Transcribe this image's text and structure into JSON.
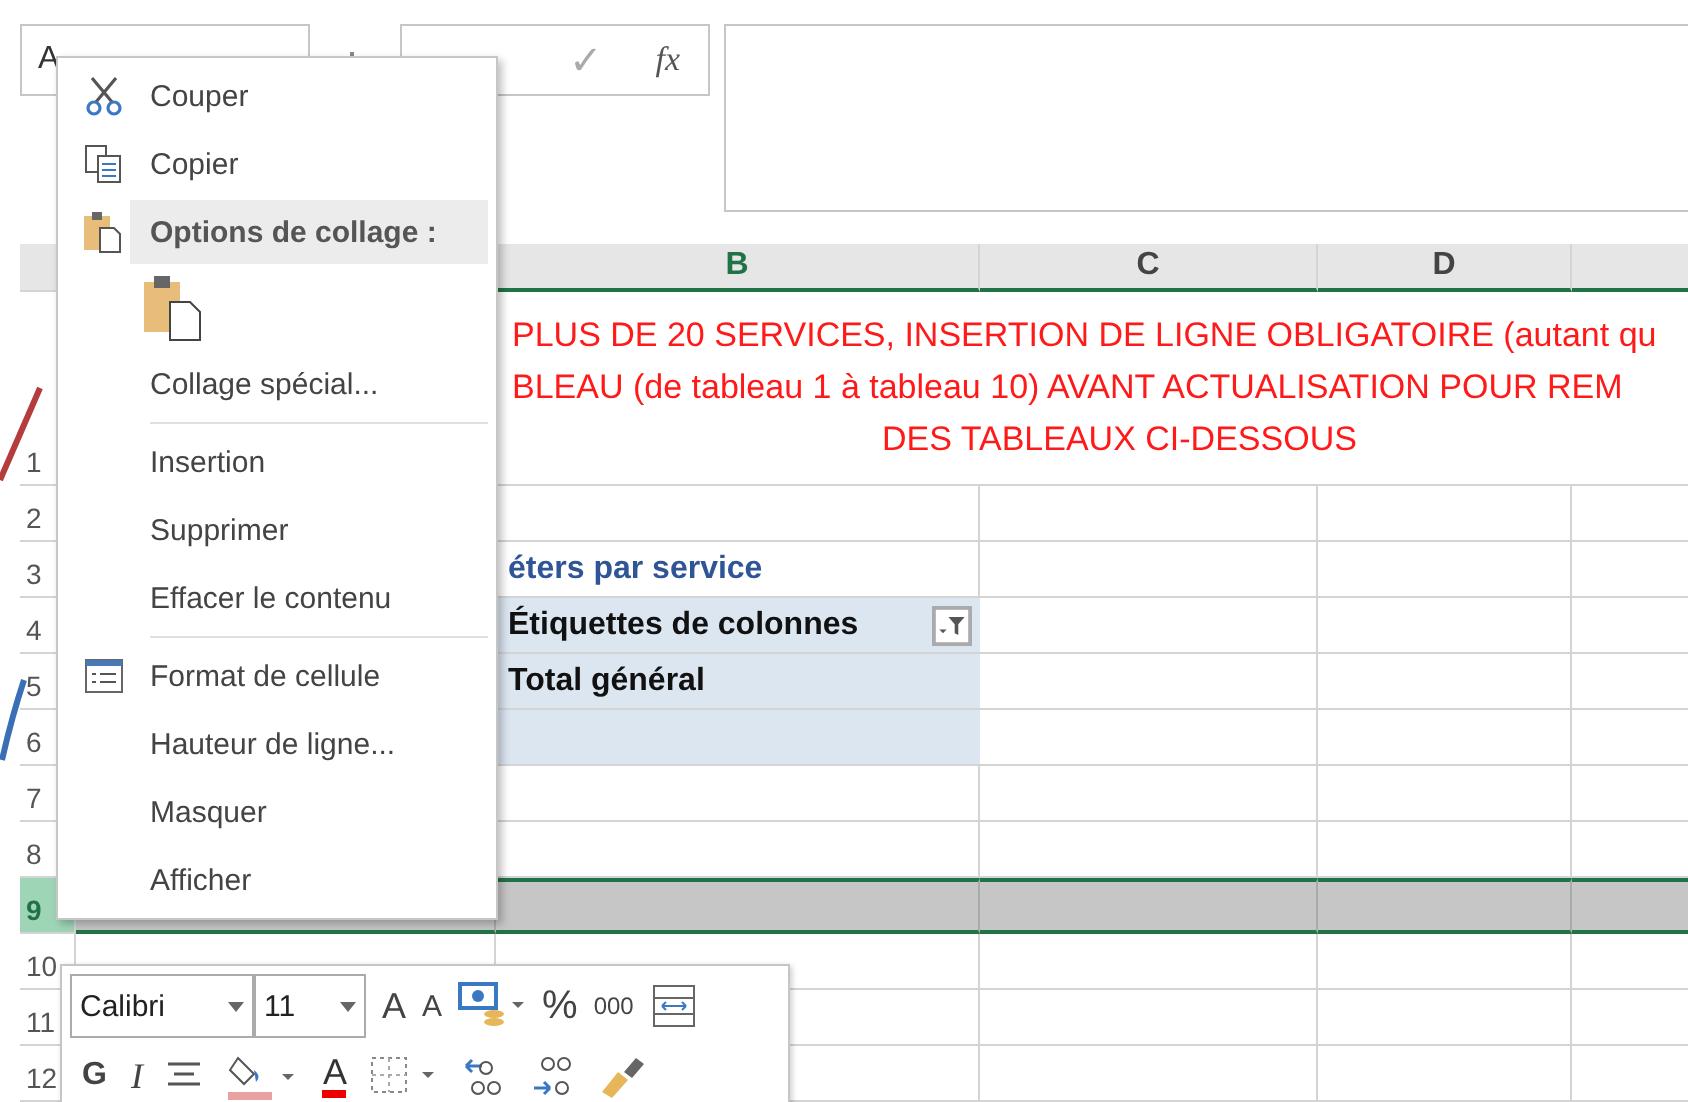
{
  "name_box": {
    "value": "A"
  },
  "formula_bar": {
    "enter": "✓",
    "function": "fx"
  },
  "columns": [
    {
      "label": "B",
      "selected": true
    },
    {
      "label": "C",
      "selected": false
    },
    {
      "label": "D",
      "selected": false
    }
  ],
  "rows": [
    {
      "number": "1",
      "selected": false,
      "kind": "title",
      "lines": [
        "PLUS DE 20 SERVICES, INSERTION DE LIGNE OBLIGATOIRE (autant qu",
        "BLEAU (de tableau 1 à tableau 10)  AVANT ACTUALISATION POUR REM",
        "DES TABLEAUX CI-DESSOUS"
      ]
    },
    {
      "number": "2",
      "selected": false,
      "kind": "empty"
    },
    {
      "number": "3",
      "selected": false,
      "kind": "heading",
      "text": "éters par service"
    },
    {
      "number": "4",
      "selected": false,
      "kind": "pivot-filter",
      "text": "Étiquettes de colonnes"
    },
    {
      "number": "5",
      "selected": false,
      "kind": "pivot",
      "text": "Total général"
    },
    {
      "number": "6",
      "selected": false,
      "kind": "pivot"
    },
    {
      "number": "7",
      "selected": false,
      "kind": "empty"
    },
    {
      "number": "8",
      "selected": false,
      "kind": "empty"
    },
    {
      "number": "9",
      "selected": true,
      "kind": "empty"
    },
    {
      "number": "10",
      "selected": false,
      "kind": "empty"
    },
    {
      "number": "11",
      "selected": false,
      "kind": "empty"
    },
    {
      "number": "12",
      "selected": false,
      "kind": "empty"
    }
  ],
  "context_menu": [
    {
      "kind": "cut",
      "label": "Couper"
    },
    {
      "kind": "copy",
      "label": "Copier"
    },
    {
      "kind": "section",
      "label": "Options de collage :"
    },
    {
      "kind": "paste"
    },
    {
      "kind": "plain",
      "label": "Collage spécial..."
    },
    {
      "kind": "separator"
    },
    {
      "kind": "plain",
      "label": "Insertion"
    },
    {
      "kind": "plain",
      "label": "Supprimer"
    },
    {
      "kind": "plain",
      "label": "Effacer le contenu"
    },
    {
      "kind": "separator"
    },
    {
      "kind": "format",
      "label": "Format de cellule"
    },
    {
      "kind": "plain",
      "label": "Hauteur de ligne..."
    },
    {
      "kind": "plain",
      "label": "Masquer"
    },
    {
      "kind": "plain",
      "label": "Afficher"
    }
  ],
  "mini_toolbar": {
    "font": "Calibri",
    "size": "11",
    "grow_font": "A",
    "shrink_font": "A",
    "percent": "%",
    "thousands": "000",
    "bold": "G",
    "italic": "I",
    "font_color": "A"
  }
}
